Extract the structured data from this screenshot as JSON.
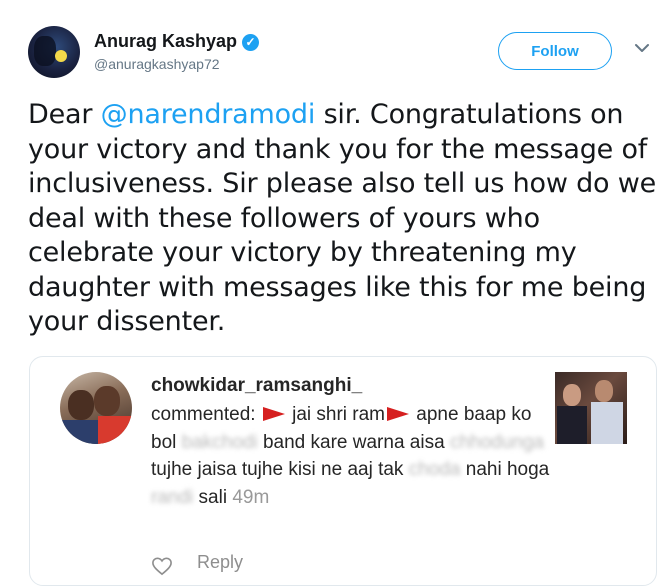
{
  "author": {
    "name": "Anurag Kashyap",
    "verified_glyph": "✓",
    "handle": "@anuragkashyap72"
  },
  "follow_label": "Follow",
  "tweet": {
    "prefix": "Dear ",
    "mention": "@narendramodi",
    "body": " sir. Congratulations on your victory and thank you for the message of inclusiveness. Sir please also tell us how do we deal with these followers of yours who celebrate your victory by threatening my daughter with messages like this for me being your dissenter."
  },
  "comment": {
    "username": "chowkidar_ramsanghi_",
    "seg1": "commented: ",
    "seg2": " jai shri ram",
    "seg3": " apne baap ko bol ",
    "blur1": "bakchodi",
    "seg4": " band kare warna aisa ",
    "blur2": "chhodunga",
    "seg5": " tujhe jaisa tujhe kisi ne aaj tak ",
    "blur3": "choda",
    "seg6": " nahi hoga ",
    "blur4": "randi",
    "seg7": " sali ",
    "time": "49m",
    "reply_label": "Reply"
  },
  "colors": {
    "accent": "#1da1f2",
    "flag": "#d62020"
  },
  "icons": [
    "verified-icon",
    "chevron-down-icon",
    "red-flag-icon",
    "heart-icon"
  ]
}
